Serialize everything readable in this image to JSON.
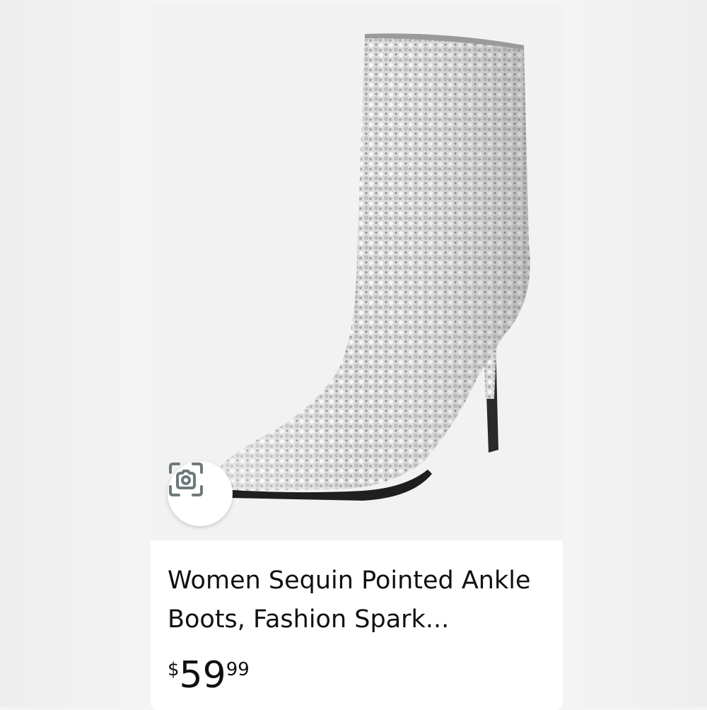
{
  "product": {
    "title": "Women Sequin Pointed Ankle Boots, Fashion Spark...",
    "price": {
      "symbol": "$",
      "whole": "59",
      "fraction": "99"
    }
  },
  "image": {
    "subject": "boot-image",
    "background_color": "#f2f2f2"
  },
  "icons": {
    "lens": "visual-search-icon"
  }
}
